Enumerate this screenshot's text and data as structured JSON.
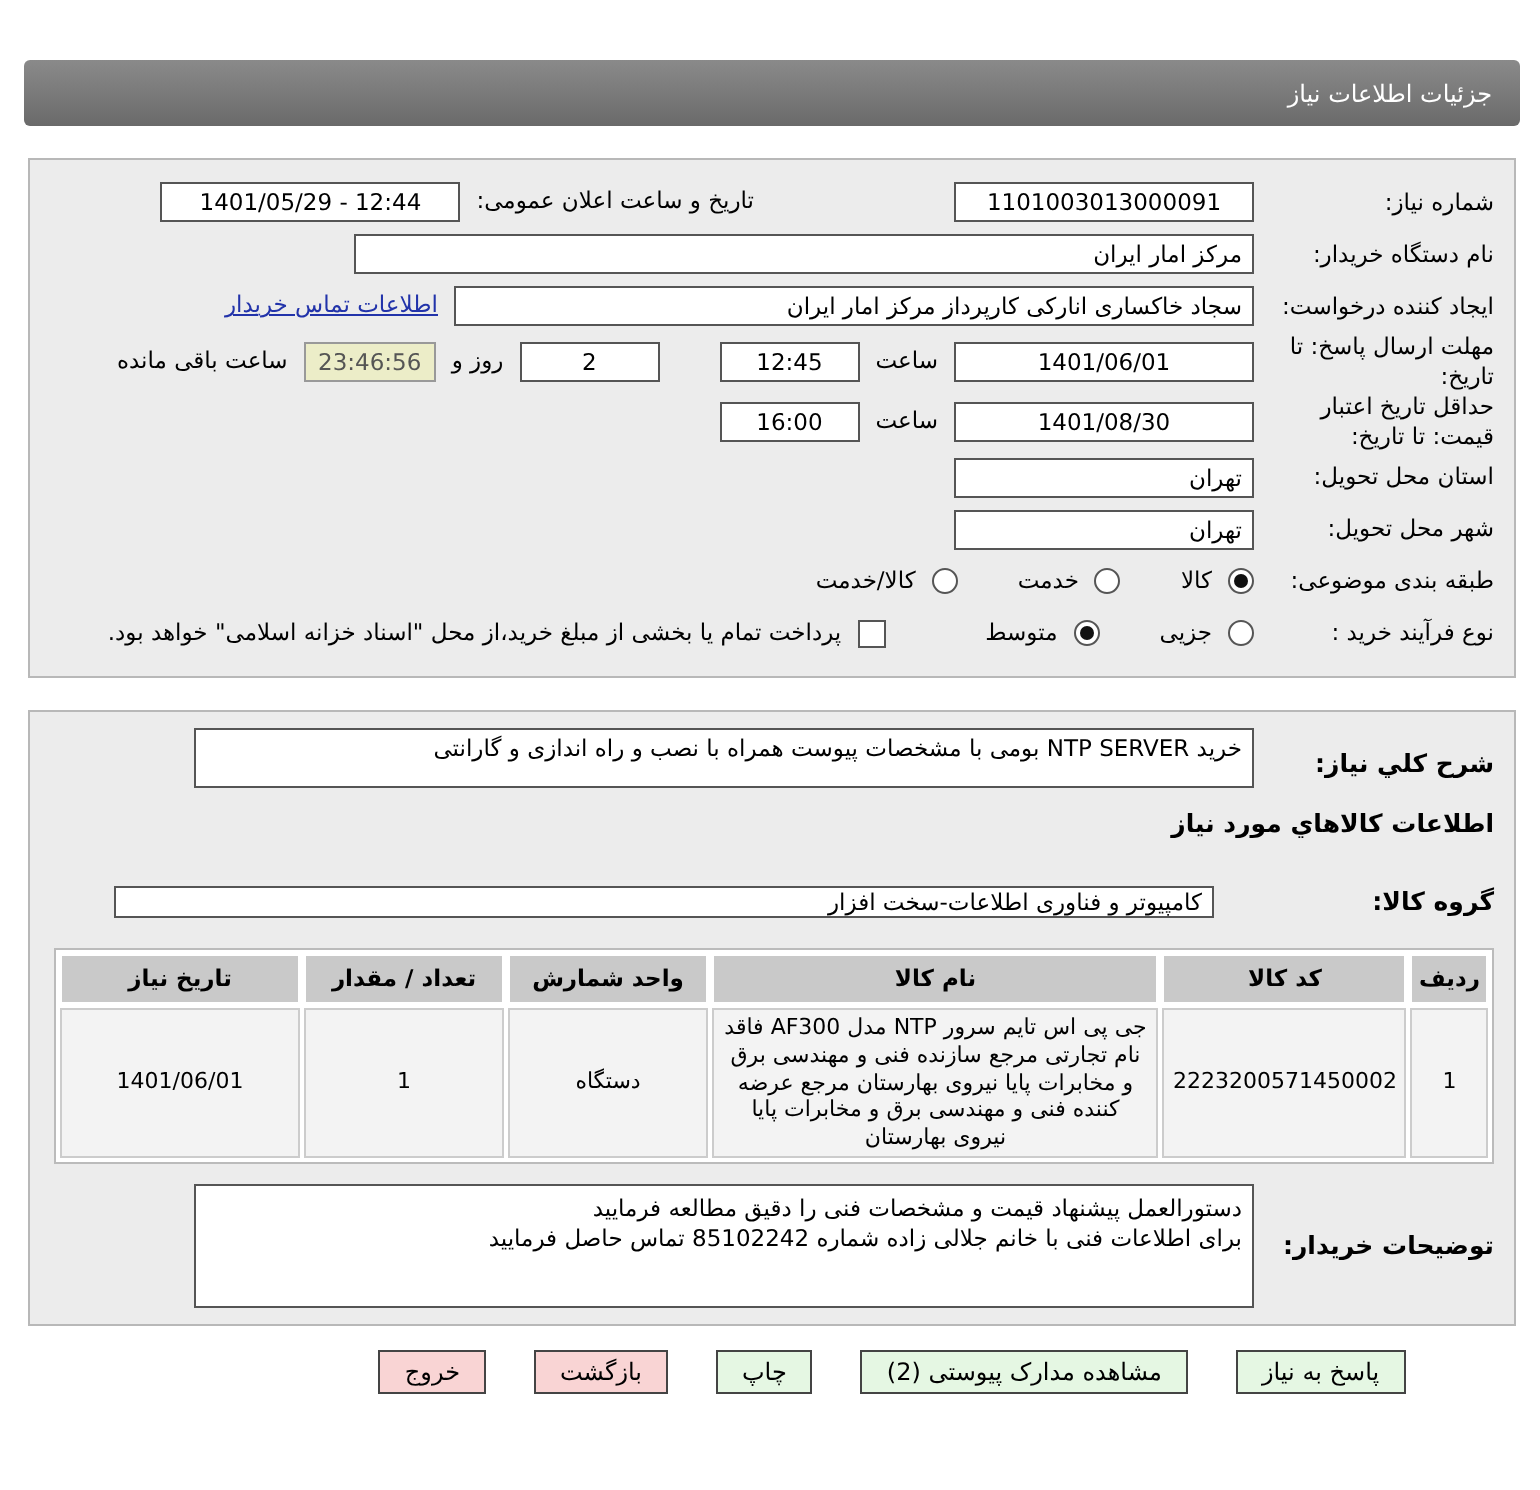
{
  "header": {
    "title": "جزئیات اطلاعات نیاز"
  },
  "need_number": {
    "label": "شماره نیاز:",
    "value": "1101003013000091"
  },
  "announce": {
    "label": "تاریخ و ساعت اعلان عمومی:",
    "value": "1401/05/29 - 12:44"
  },
  "buyer": {
    "label": "نام دستگاه خریدار:",
    "value": "مرکز امار ایران"
  },
  "requester": {
    "label": "ایجاد کننده درخواست:",
    "value": "سجاد خاکساری اناركی کارپرداز مرکز امار ایران",
    "link": "اطلاعات تماس خریدار"
  },
  "deadline": {
    "label": "مهلت ارسال پاسخ: تا تاریخ:",
    "date": "1401/06/01",
    "time_label": "ساعت",
    "time": "12:45",
    "days": "2",
    "days_label": "روز و",
    "remaining": "23:46:56",
    "remaining_label": "ساعت باقی مانده"
  },
  "validity": {
    "label": "حداقل تاریخ اعتبار قیمت: تا تاریخ:",
    "date": "1401/08/30",
    "time_label": "ساعت",
    "time": "16:00"
  },
  "province": {
    "label": "استان محل تحویل:",
    "value": "تهران"
  },
  "city": {
    "label": "شهر محل تحویل:",
    "value": "تهران"
  },
  "category": {
    "label": "طبقه بندی موضوعی:",
    "options": [
      {
        "label": "کالا",
        "selected": true
      },
      {
        "label": "خدمت",
        "selected": false
      },
      {
        "label": "کالا/خدمت",
        "selected": false
      }
    ]
  },
  "process": {
    "label": "نوع فرآیند خرید :",
    "options": [
      {
        "label": "جزیی",
        "selected": false
      },
      {
        "label": "متوسط",
        "selected": true
      }
    ],
    "payment": {
      "checked": false,
      "label": "پرداخت تمام یا بخشی از مبلغ خرید،از محل \"اسناد خزانه اسلامی\" خواهد بود."
    }
  },
  "description": {
    "label": "شرح كلي نياز:",
    "value": "خرید  NTP SERVER  بومی با مشخصات پیوست همراه با نصب و راه اندازی و گارانتی"
  },
  "goods_title": "اطلاعات كالاهاي مورد نياز",
  "goods_group": {
    "label": "گروه کالا:",
    "value": "کامپیوتر و فناوری اطلاعات-سخت افزار"
  },
  "table": {
    "columns": [
      "ردیف",
      "کد کالا",
      "نام کالا",
      "واحد شمارش",
      "تعداد / مقدار",
      "تاریخ نیاز"
    ],
    "rows": [
      [
        "1",
        "2223200571450002",
        "جی پی اس تایم سرور NTP مدل AF300 فاقد نام تجارتی مرجع سازنده فنی و مهندسی برق و مخابرات پایا نیروی بهارستان مرجع عرضه کننده فنی و مهندسی برق و مخابرات پایا نیروی بهارستان",
        "دستگاه",
        "1",
        "1401/06/01"
      ]
    ]
  },
  "buyer_notes": {
    "label": "توضیحات خریدار:",
    "lines": [
      "دستورالعمل پیشنهاد قیمت و مشخصات فنی را دقیق مطالعه فرمایید",
      "برای اطلاعات فنی با خانم جلالی زاده شماره 85102242 تماس حاصل فرمایید"
    ]
  },
  "buttons": [
    {
      "label": "پاسخ به نیاز",
      "kind": "normal"
    },
    {
      "label": "مشاهده مدارک پیوستی (2)",
      "kind": "normal"
    },
    {
      "label": "چاپ",
      "kind": "normal"
    },
    {
      "label": "بازگشت",
      "kind": "danger"
    },
    {
      "label": "خروج",
      "kind": "danger"
    }
  ]
}
